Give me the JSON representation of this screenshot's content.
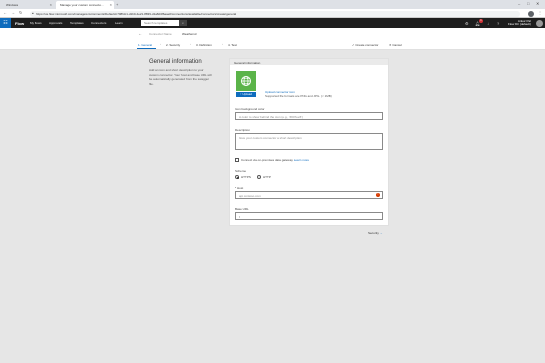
{
  "browser": {
    "tabs": [
      {
        "label": "Windows"
      },
      {
        "label": "Manage your custom connecto..."
      }
    ],
    "url": "https://us.flow.microsoft.com/manage/environments/Default-b708fdc1-d1b0-4e21-8839-d1a8d4f6aae0/connections/available/connectors/create/general"
  },
  "header": {
    "brand": "Flow",
    "nav": [
      "My flows",
      "Approvals",
      "Templates",
      "Connectors",
      "Learn"
    ],
    "search_placeholder": "Search templates",
    "notification_count": "1",
    "user_name": "Ankur Pal",
    "user_org": "Flow Dir (default)"
  },
  "connector": {
    "name_label": "Connector Name",
    "name_value": "Weatherxd"
  },
  "steps": [
    {
      "label": "1. General"
    },
    {
      "label": "2. Security"
    },
    {
      "label": "3. Definition"
    },
    {
      "label": "4. Test"
    }
  ],
  "actions": {
    "create": "Create connector",
    "cancel": "Cancel"
  },
  "intro": {
    "title": "General information",
    "description": "Add an icon and short description to your custom connector. Your host and base URL will be automatically generated from the swagger file."
  },
  "form": {
    "section_header": "General information",
    "upload_button": "Upload",
    "upload_link": "Upload connector icon",
    "upload_hint": "Supported file formats are PNG and JPG. (< 1MB)",
    "bg_color_label": "Icon background color",
    "bg_color_placeholder": "A color to show behind the icon (e.g., '#007ee5')",
    "description_label": "Description",
    "description_placeholder": "Give your custom connector a short description",
    "gateway_label": "Connect via on-premises data gateway",
    "gateway_link": "Learn more",
    "scheme_label": "Scheme",
    "scheme_options": [
      "HTTPS",
      "HTTP"
    ],
    "host_label": "* Host",
    "host_placeholder": "api.contoso.com",
    "base_url_label": "Base URL",
    "base_url_value": "/"
  },
  "footer": {
    "next_label": "Security"
  }
}
